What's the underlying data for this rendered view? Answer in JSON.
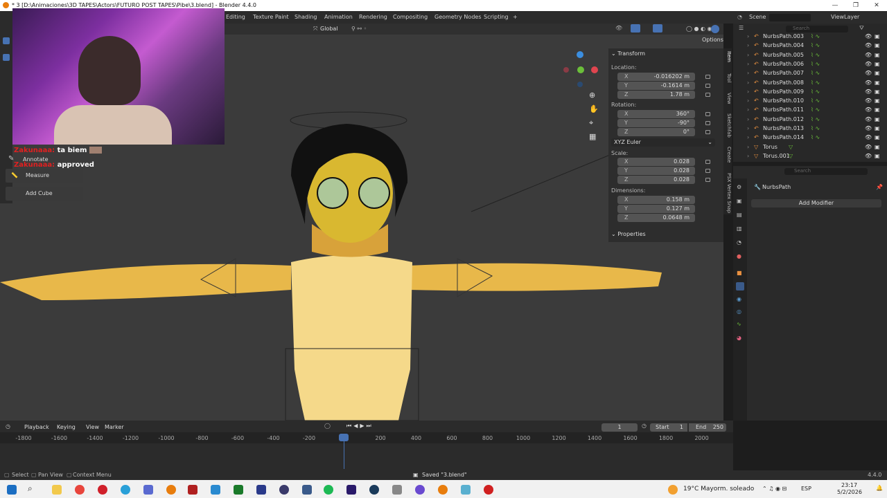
{
  "window": {
    "title": "* 3 [D:\\Animaciones\\3D TAPES\\Actors\\FUTURO POST TAPES\\Pibe\\3.blend] - Blender 4.4.0",
    "min": "—",
    "restore": "❐",
    "close": "✕"
  },
  "workspaces": [
    "Editing",
    "Texture Paint",
    "Shading",
    "Animation",
    "Rendering",
    "Compositing",
    "Geometry Nodes",
    "Scripting",
    "+"
  ],
  "scene": {
    "label": "Scene",
    "viewlayer": "ViewLayer"
  },
  "viewport": {
    "orientation": "Global",
    "options_label": "Options"
  },
  "chat": {
    "messages": [
      {
        "user": "Zakunaaa:",
        "text": "ta biem"
      },
      {
        "user": "Zakunaaa:",
        "text": "approved"
      }
    ]
  },
  "tools": {
    "annotate": "Annotate",
    "measure": "Measure",
    "add_cube": "Add Cube"
  },
  "transform": {
    "header": "Transform",
    "location_label": "Location:",
    "location": [
      {
        "axis": "X",
        "value": "-0.016202 m"
      },
      {
        "axis": "Y",
        "value": "-0.1614 m"
      },
      {
        "axis": "Z",
        "value": "1.78 m"
      }
    ],
    "rotation_label": "Rotation:",
    "rotation": [
      {
        "axis": "X",
        "value": "360°"
      },
      {
        "axis": "Y",
        "value": "-90°"
      },
      {
        "axis": "Z",
        "value": "0°"
      }
    ],
    "rotation_mode": "XYZ Euler",
    "scale_label": "Scale:",
    "scale": [
      {
        "axis": "X",
        "value": "0.028"
      },
      {
        "axis": "Y",
        "value": "0.028"
      },
      {
        "axis": "Z",
        "value": "0.028"
      }
    ],
    "dimensions_label": "Dimensions:",
    "dimensions": [
      {
        "axis": "X",
        "value": "0.158 m"
      },
      {
        "axis": "Y",
        "value": "0.127 m"
      },
      {
        "axis": "Z",
        "value": "0.0648 m"
      }
    ],
    "properties_header": "Properties"
  },
  "sidebar_tabs": [
    "Item",
    "Tool",
    "View",
    "Sketchfab",
    "Create",
    "PSX Vertex Snap"
  ],
  "outliner": {
    "search_placeholder": "Search",
    "items": [
      "NurbsPath.003",
      "NurbsPath.004",
      "NurbsPath.005",
      "NurbsPath.006",
      "NurbsPath.007",
      "NurbsPath.008",
      "NurbsPath.009",
      "NurbsPath.010",
      "NurbsPath.011",
      "NurbsPath.012",
      "NurbsPath.013",
      "NurbsPath.014",
      "Torus",
      "Torus.001"
    ]
  },
  "properties": {
    "search_placeholder": "Search",
    "object_name": "NurbsPath",
    "add_modifier": "Add Modifier"
  },
  "timeline": {
    "menus": [
      "Playback",
      "Keying",
      "View",
      "Marker"
    ],
    "current_frame": "1",
    "start_label": "Start",
    "start": "1",
    "end_label": "End",
    "end": "250",
    "ticks": [
      "-1800",
      "-1600",
      "-1400",
      "-1200",
      "-1000",
      "-800",
      "-600",
      "-400",
      "-200",
      "1",
      "200",
      "400",
      "600",
      "800",
      "1000",
      "1200",
      "1400",
      "1600",
      "1800",
      "2000"
    ]
  },
  "statusbar": {
    "select": "Select",
    "pan": "Pan View",
    "context": "Context Menu",
    "saved": "Saved \"3.blend\"",
    "version": "4.4.0"
  },
  "taskbar": {
    "weather": "19°C  Mayorm. soleado",
    "lang": "ESP",
    "time": "23:17",
    "date": "5/2/2026"
  }
}
